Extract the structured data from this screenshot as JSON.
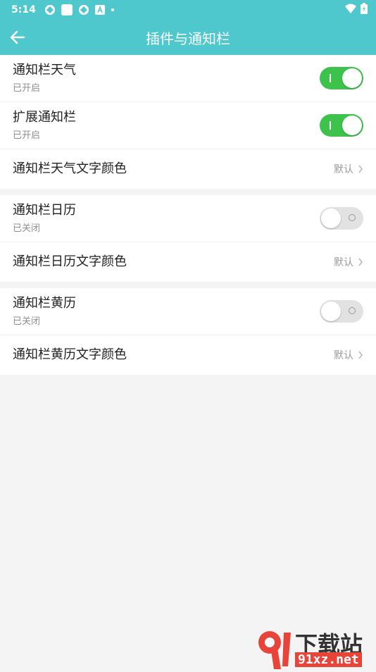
{
  "status_bar": {
    "time": "5:14"
  },
  "app_bar": {
    "title": "插件与通知栏",
    "back_icon": "arrow-left-icon"
  },
  "groups": [
    {
      "rows": [
        {
          "label": "通知栏天气",
          "sub": "已开启",
          "toggle": true
        },
        {
          "label": "扩展通知栏",
          "sub": "已开启",
          "toggle": true
        },
        {
          "label": "通知栏天气文字颜色",
          "value": "默认"
        }
      ]
    },
    {
      "rows": [
        {
          "label": "通知栏日历",
          "sub": "已关闭",
          "toggle": false
        },
        {
          "label": "通知栏日历文字颜色",
          "value": "默认"
        }
      ]
    },
    {
      "rows": [
        {
          "label": "通知栏黄历",
          "sub": "已关闭",
          "toggle": false
        },
        {
          "label": "通知栏黄历文字颜色",
          "value": "默认"
        }
      ]
    }
  ],
  "watermark": {
    "logo_text": "下载站",
    "url": "91xz.net"
  },
  "colors": {
    "accent": "#4ec8cd",
    "toggle_on": "#3dc34b",
    "toggle_off": "#e2e2e2",
    "background": "#f4f4f4"
  }
}
